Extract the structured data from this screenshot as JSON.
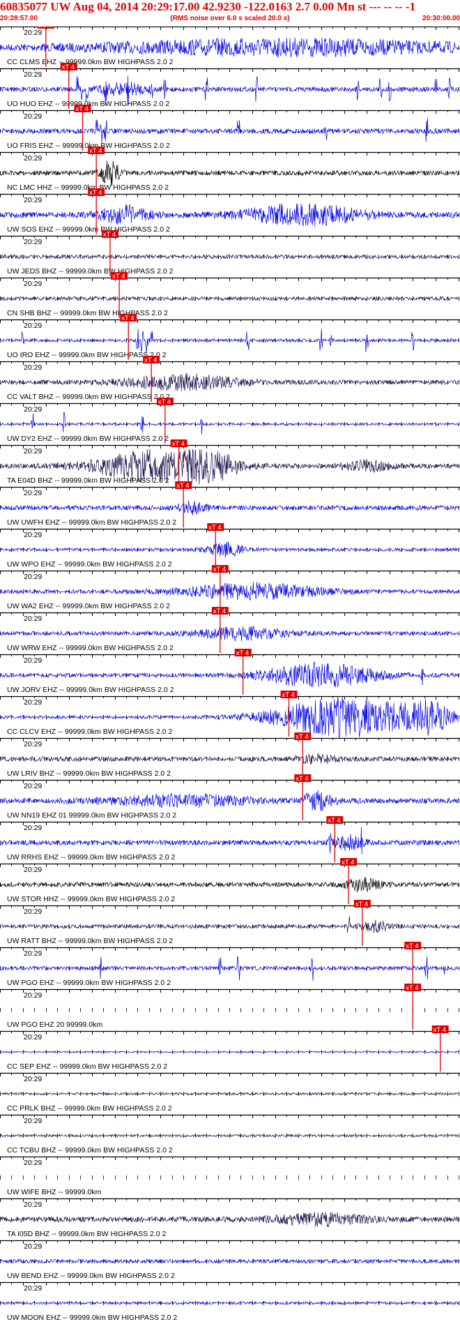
{
  "header": {
    "title": "60835077 UW Aug 04, 2014 20:29:17.00   42.9230 -122.0163  2.7 0.00 Mn st --- -- --   -1",
    "time_start": "20:28:57.00",
    "rms_note": "(RMS noise over 6.0 s scaled 20.0 x)",
    "time_end": "20:30:00.00"
  },
  "colors": {
    "accent": "#e00000",
    "trace_blue": "#0000ee",
    "trace_dark": "#1a0a4a",
    "trace_black": "#000000"
  },
  "chart_data": {
    "type": "line",
    "x_range": [
      "20:28:57.00",
      "20:30:00.00"
    ],
    "tick_label": "20:29",
    "pick_label": "xT 4",
    "traces": [
      {
        "label": "CC CLMS EHZ -- 99999.0km BW  HIGHPASS  2.0  2",
        "color": "blue",
        "pick": 0.1,
        "burst": [
          [
            0.62,
            0.4,
            0.38
          ]
        ],
        "base": 0.14,
        "spikes": []
      },
      {
        "label": "UO HUO EHZ -- 99999.0km BW  HIGHPASS  2.0  2",
        "color": "blue",
        "pick": 0.15,
        "burst": [
          [
            0.27,
            0.05,
            0.3
          ]
        ],
        "base": 0.12,
        "spikes": [
          0.17,
          0.18,
          0.19,
          0.23,
          0.28,
          0.33,
          0.36,
          0.45,
          0.56,
          0.78,
          0.83,
          0.85,
          0.95,
          0.98
        ]
      },
      {
        "label": "UO FRIS EHZ -- 99999.0km BW  HIGHPASS  2.0  2",
        "color": "blue",
        "pick": 0.18,
        "burst": [],
        "base": 0.13,
        "spikes": [
          0.21,
          0.22,
          0.23,
          0.52,
          0.71,
          0.93
        ]
      },
      {
        "label": "NC LMC HHZ -- 99999.0km BW  HIGHPASS  2.0  2",
        "color": "black",
        "pick": 0.21,
        "burst": [
          [
            0.24,
            0.02,
            0.6
          ]
        ],
        "base": 0.12,
        "spikes": []
      },
      {
        "label": "UW SOS EHZ -- 99999.0km BW  HIGHPASS  2.0  2",
        "color": "blue",
        "pick": 0.21,
        "burst": [
          [
            0.27,
            0.05,
            0.4
          ],
          [
            0.66,
            0.12,
            0.5
          ]
        ],
        "base": 0.15,
        "spikes": []
      },
      {
        "label": "UW JEDS BHZ -- 99999.0km BW  HIGHPASS  2.0  2",
        "color": "dark",
        "pick": 0.24,
        "burst": [],
        "base": 0.1,
        "spikes": []
      },
      {
        "label": "CN SHB BHZ -- 99999.0km BW  HIGHPASS  2.0  2",
        "color": "dark",
        "pick": 0.26,
        "burst": [],
        "base": 0.1,
        "spikes": []
      },
      {
        "label": "UO IRO EHZ -- 99999.0km BW  HIGHPASS  2.0  2",
        "color": "blue",
        "pick": 0.28,
        "burst": [],
        "base": 0.08,
        "spikes": [
          0.05,
          0.3,
          0.31,
          0.32,
          0.33,
          0.54,
          0.7,
          0.72,
          0.8,
          0.9
        ]
      },
      {
        "label": "CC VALT BHZ -- 99999.0km BW  HIGHPASS  2.0  2",
        "color": "dark",
        "pick": 0.33,
        "burst": [
          [
            0.4,
            0.12,
            0.35
          ]
        ],
        "base": 0.12,
        "spikes": []
      },
      {
        "label": "UW DY2 EHZ -- 99999.0km BW  HIGHPASS  2.0  2",
        "color": "blue",
        "pick": 0.36,
        "burst": [],
        "base": 0.06,
        "spikes": [
          0.07,
          0.14,
          0.31,
          0.44
        ]
      },
      {
        "label": "TA E04D BHZ -- 99999.0km BW  HIGHPASS  2.0  2",
        "color": "dark",
        "pick": 0.39,
        "burst": [
          [
            0.33,
            0.12,
            0.75
          ],
          [
            0.46,
            0.06,
            0.6
          ],
          [
            0.8,
            0.05,
            0.25
          ]
        ],
        "base": 0.12,
        "spikes": []
      },
      {
        "label": "UW UWFH EHZ -- 99999.0km BW  HIGHPASS  2.0  2",
        "color": "blue",
        "pick": 0.4,
        "burst": [
          [
            0.42,
            0.03,
            0.3
          ]
        ],
        "base": 0.12,
        "spikes": []
      },
      {
        "label": "UW WPO EHZ -- 99999.0km BW  HIGHPASS  2.0  2",
        "color": "blue",
        "pick": 0.47,
        "burst": [
          [
            0.49,
            0.04,
            0.35
          ]
        ],
        "base": 0.08,
        "spikes": []
      },
      {
        "label": "UW WA2 EHZ -- 99999.0km BW  HIGHPASS  2.0  2",
        "color": "blue",
        "pick": 0.48,
        "burst": [
          [
            0.55,
            0.15,
            0.4
          ]
        ],
        "base": 0.1,
        "spikes": []
      },
      {
        "label": "UW WRW EHZ -- 99999.0km BW  HIGHPASS  2.0  2",
        "color": "blue",
        "pick": 0.48,
        "burst": [
          [
            0.53,
            0.1,
            0.3
          ]
        ],
        "base": 0.1,
        "spikes": []
      },
      {
        "label": "UW JORV EHZ -- 99999.0km BW  HIGHPASS  2.0  2",
        "color": "blue",
        "pick": 0.53,
        "burst": [
          [
            0.7,
            0.12,
            0.6
          ]
        ],
        "base": 0.1,
        "spikes": [
          0.92
        ]
      },
      {
        "label": "CC CLCV EHZ -- 99999.0km BW  HIGHPASS  2.0  2",
        "color": "blue",
        "pick": 0.63,
        "burst": [
          [
            0.75,
            0.15,
            1.0
          ],
          [
            0.93,
            0.05,
            0.7
          ]
        ],
        "base": 0.08,
        "spikes": []
      },
      {
        "label": "UW LRIV BHZ -- 99999.0km BW  HIGHPASS  2.0  2",
        "color": "dark",
        "pick": 0.66,
        "burst": [
          [
            0.69,
            0.04,
            0.2
          ]
        ],
        "base": 0.12,
        "spikes": []
      },
      {
        "label": "UW NN19 EHZ 01 99999.0km BW  HIGHPASS  2.0  2",
        "color": "blue",
        "pick": 0.66,
        "burst": [
          [
            0.4,
            0.15,
            0.25
          ],
          [
            0.69,
            0.03,
            0.45
          ]
        ],
        "base": 0.14,
        "spikes": []
      },
      {
        "label": "UW RRHS EHZ -- 99999.0km BW  HIGHPASS  2.0  2",
        "color": "blue",
        "pick": 0.73,
        "burst": [
          [
            0.76,
            0.03,
            0.35
          ]
        ],
        "base": 0.13,
        "spikes": [
          0.72,
          0.79
        ]
      },
      {
        "label": "UW STOR HHZ -- 99999.0km BW  HIGHPASS  2.0  2",
        "color": "black",
        "pick": 0.76,
        "burst": [
          [
            0.79,
            0.04,
            0.3
          ]
        ],
        "base": 0.12,
        "spikes": []
      },
      {
        "label": "UW RATT BHZ -- 99999.0km BW  HIGHPASS  2.0  2",
        "color": "dark",
        "pick": 0.79,
        "burst": [
          [
            0.82,
            0.03,
            0.25
          ]
        ],
        "base": 0.1,
        "spikes": [
          0.76
        ]
      },
      {
        "label": "UW PGO EHZ -- 99999.0km BW  HIGHPASS  2.0  2",
        "color": "blue",
        "pick": 0.9,
        "burst": [],
        "base": 0.1,
        "spikes": [
          0.22,
          0.48,
          0.52,
          0.68,
          0.93,
          0.97
        ]
      },
      {
        "label": "UW PGO EHZ 20 99999.0km",
        "color": "none",
        "pick": 0.9,
        "burst": [],
        "base": 0,
        "spikes": []
      },
      {
        "label": "CC SEP EHZ -- 99999.0km BW  HIGHPASS  2.0  2",
        "color": "blue",
        "pick": 0.96,
        "burst": [],
        "base": 0.04,
        "spikes": []
      },
      {
        "label": "CC PRLK BHZ -- 99999.0km BW  HIGHPASS  2.0  2",
        "color": "dark",
        "pick": null,
        "burst": [],
        "base": 0.06,
        "spikes": []
      },
      {
        "label": "CC TCBU BHZ -- 99999.0km BW  HIGHPASS  2.0  2",
        "color": "dark",
        "pick": null,
        "burst": [],
        "base": 0.06,
        "spikes": []
      },
      {
        "label": "UW WIFE BHZ -- 99999.0km",
        "color": "none",
        "pick": null,
        "burst": [],
        "base": 0,
        "spikes": []
      },
      {
        "label": "TA I05D BHZ -- 99999.0km BW  HIGHPASS  2.0  2",
        "color": "dark",
        "pick": null,
        "burst": [
          [
            0.7,
            0.1,
            0.25
          ]
        ],
        "base": 0.14,
        "spikes": []
      },
      {
        "label": "UW BEND EHZ -- 99999.0km BW  HIGHPASS  2.0  2",
        "color": "blue",
        "pick": null,
        "burst": [],
        "base": 0.1,
        "spikes": []
      },
      {
        "label": "UW MOON EHZ -- 99999.0km BW  HIGHPASS  2.0  2",
        "color": "blue",
        "pick": null,
        "burst": [],
        "base": 0.07,
        "spikes": []
      }
    ]
  }
}
